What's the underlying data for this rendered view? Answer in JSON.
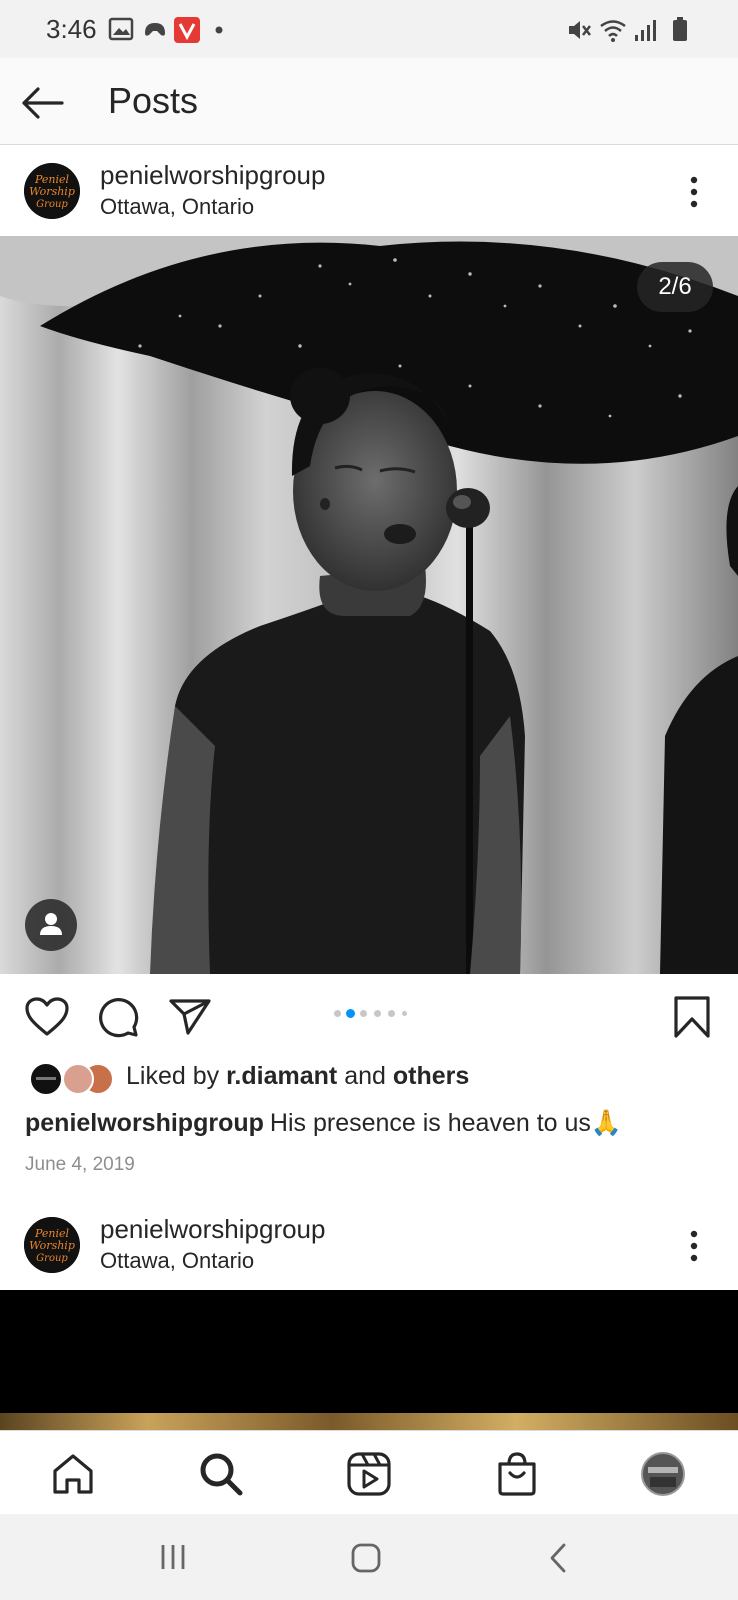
{
  "status": {
    "time": "3:46"
  },
  "header": {
    "title": "Posts"
  },
  "post1": {
    "username": "penielworshipgroup",
    "location": "Ottawa, Ontario",
    "counter": "2/6",
    "liked_prefix": "Liked by",
    "liked_user": "r.diamant",
    "liked_and": "and",
    "liked_others": "others",
    "caption_user": "penielworshipgroup",
    "caption_text": "His presence is heaven to us🙏",
    "date": "June 4, 2019",
    "carousel_total": 6,
    "carousel_active": 2
  },
  "post2": {
    "username": "penielworshipgroup",
    "location": "Ottawa, Ontario"
  },
  "avatar_logo": {
    "line1": "Peniel",
    "line2": "Worship",
    "line3": "Group"
  },
  "colors": {
    "accent_blue": "#0095f6",
    "logo_orange": "#e8852b"
  }
}
